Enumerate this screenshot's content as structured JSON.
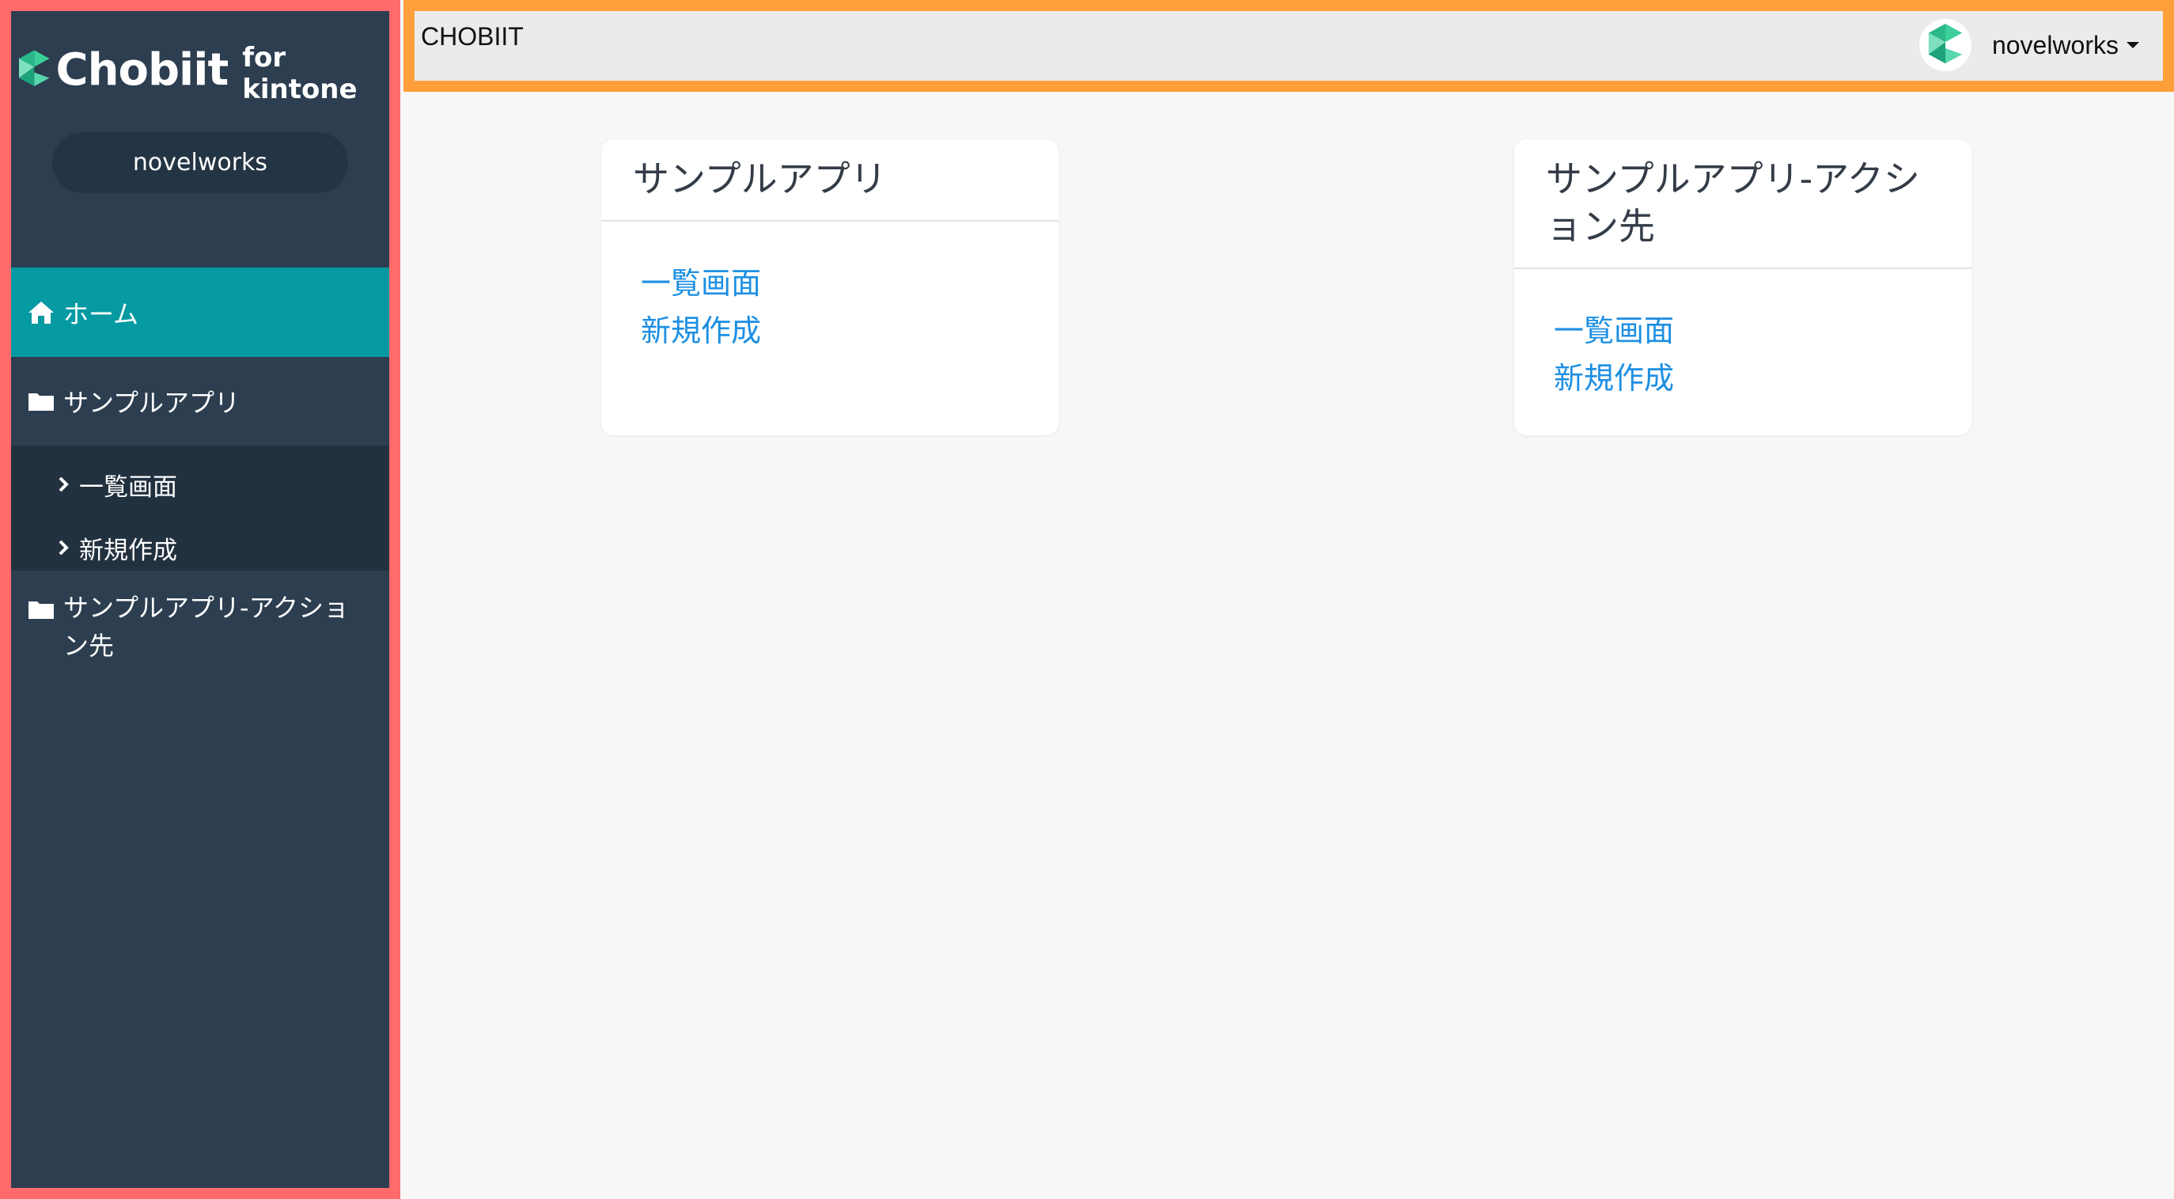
{
  "sidebar": {
    "logo_text": "Chobiit",
    "logo_sub": "for kintone",
    "user": "novelworks",
    "home_label": "ホーム",
    "apps": [
      {
        "label": "サンプルアプリ",
        "sub": [
          "一覧画面",
          "新規作成"
        ]
      },
      {
        "label": "サンプルアプリ-アクション先"
      }
    ]
  },
  "header": {
    "brand": "CHOBIIT",
    "user": "novelworks"
  },
  "cards": [
    {
      "title": "サンプルアプリ",
      "links": [
        "一覧画面",
        "新規作成"
      ]
    },
    {
      "title": "サンプルアプリ-アクション先",
      "links": [
        "一覧画面",
        "新規作成"
      ]
    }
  ],
  "colors": {
    "sidebar_frame": "#ff6b6b",
    "header_frame": "#ff9f3a",
    "sidebar_bg": "#2c3e50",
    "active": "#069aa2",
    "link": "#1d8fe3"
  }
}
